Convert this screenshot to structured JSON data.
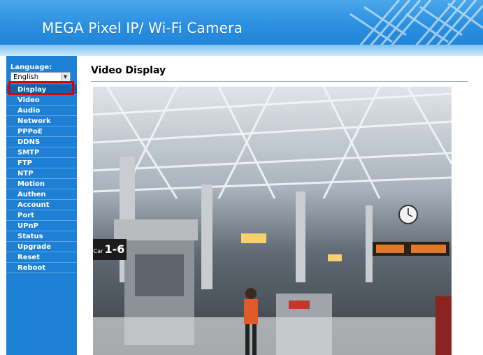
{
  "header": {
    "title": "MEGA Pixel IP/ Wi-Fi Camera"
  },
  "sidebar": {
    "language_label": "Language:",
    "language_value": "English",
    "items": [
      {
        "label": "Display"
      },
      {
        "label": "Video"
      },
      {
        "label": "Audio"
      },
      {
        "label": "Network"
      },
      {
        "label": "PPPoE"
      },
      {
        "label": "DDNS"
      },
      {
        "label": "SMTP"
      },
      {
        "label": "FTP"
      },
      {
        "label": "NTP"
      },
      {
        "label": "Motion"
      },
      {
        "label": "Authen"
      },
      {
        "label": "Account"
      },
      {
        "label": "Port"
      },
      {
        "label": "UPnP"
      },
      {
        "label": "Status"
      },
      {
        "label": "Upgrade"
      },
      {
        "label": "Reset"
      },
      {
        "label": "Reboot"
      }
    ],
    "active_item": "Display"
  },
  "main": {
    "title": "Video Display",
    "video": {
      "sign_text": "1-6",
      "sign_prefix": "Car"
    }
  },
  "colors": {
    "header_blue": "#2b8fe0",
    "sidebar_blue": "#1e80d4",
    "highlight": "#e00000"
  }
}
